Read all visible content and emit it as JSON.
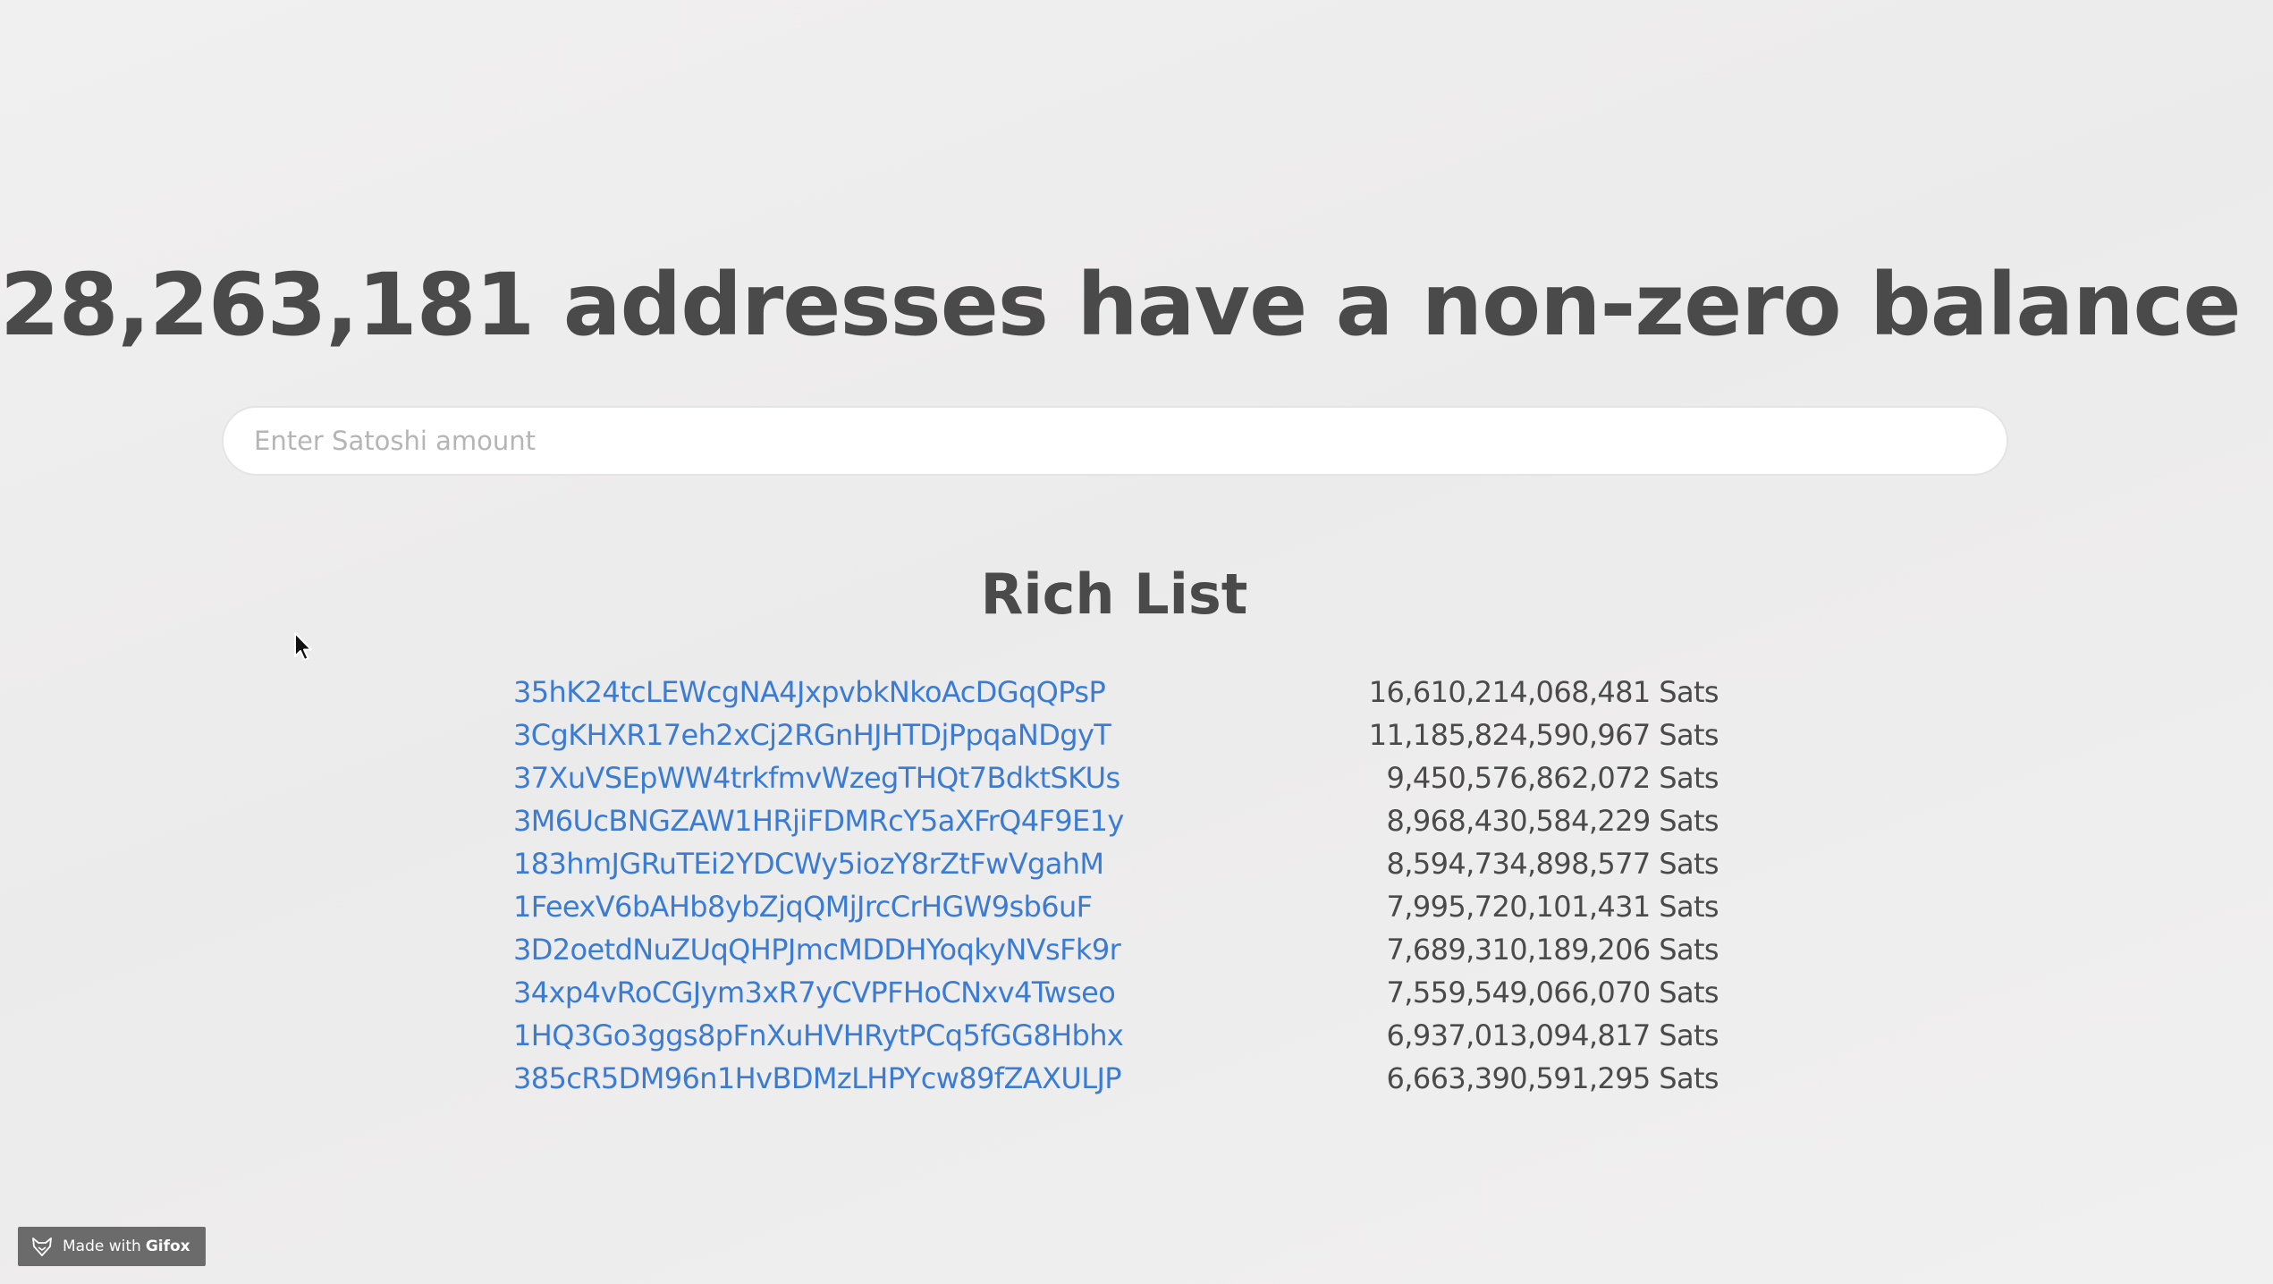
{
  "header": {
    "title": "28,263,181 addresses have a non-zero balance"
  },
  "search": {
    "placeholder": "Enter Satoshi amount",
    "value": ""
  },
  "rich_list": {
    "title": "Rich List",
    "entries": [
      {
        "address": "35hK24tcLEWcgNA4JxpvbkNkoAcDGqQPsP",
        "amount": "16,610,214,068,481 Sats"
      },
      {
        "address": "3CgKHXR17eh2xCj2RGnHJHTDjPpqaNDgyT",
        "amount": "11,185,824,590,967 Sats"
      },
      {
        "address": "37XuVSEpWW4trkfmvWzegTHQt7BdktSKUs",
        "amount": "9,450,576,862,072 Sats"
      },
      {
        "address": "3M6UcBNGZAW1HRjiFDMRcY5aXFrQ4F9E1y",
        "amount": "8,968,430,584,229 Sats"
      },
      {
        "address": "183hmJGRuTEi2YDCWy5iozY8rZtFwVgahM",
        "amount": "8,594,734,898,577 Sats"
      },
      {
        "address": "1FeexV6bAHb8ybZjqQMjJrcCrHGW9sb6uF",
        "amount": "7,995,720,101,431 Sats"
      },
      {
        "address": "3D2oetdNuZUqQHPJmcMDDHYoqkyNVsFk9r",
        "amount": "7,689,310,189,206 Sats"
      },
      {
        "address": "34xp4vRoCGJym3xR7yCVPFHoCNxv4Twseo",
        "amount": "7,559,549,066,070 Sats"
      },
      {
        "address": "1HQ3Go3ggs8pFnXuHVHRytPCq5fGG8Hbhx",
        "amount": "6,937,013,094,817 Sats"
      },
      {
        "address": "385cR5DM96n1HvBDMzLHPYcw89fZAXULJP",
        "amount": "6,663,390,591,295 Sats"
      }
    ]
  },
  "badge": {
    "prefix": "Made with",
    "brand": "Gifox",
    "icon": "fox-icon"
  },
  "colors": {
    "link": "#3a7bd5",
    "text": "#4a4a4a",
    "background": "#efeeee"
  }
}
